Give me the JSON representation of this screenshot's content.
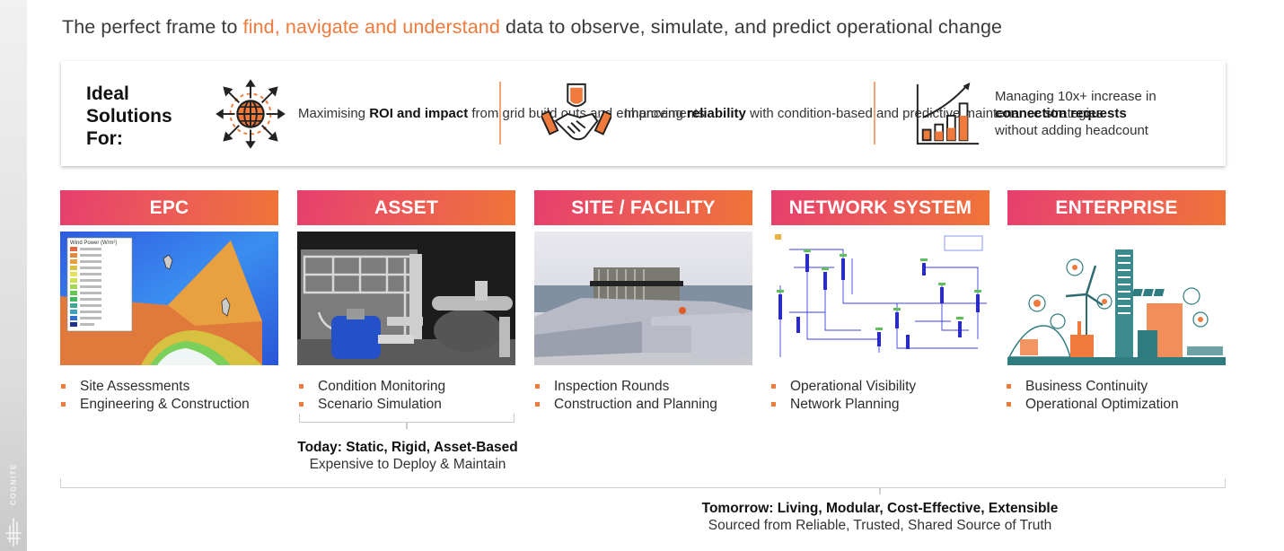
{
  "brand": {
    "name": "COGNITE"
  },
  "subtitle": {
    "prefix": "The perfect frame to ",
    "highlight": "find, navigate and understand",
    "suffix": " data to observe, simulate, and predict operational change"
  },
  "ideal": {
    "title_lines": [
      "Ideal",
      "Solutions",
      "For:"
    ],
    "benefits": [
      {
        "icon": "globe-expand-icon",
        "pre": "Maximising ",
        "bold": "ROI and impact",
        "post": " from grid build outs and enhancements"
      },
      {
        "icon": "handshake-shield-icon",
        "pre": "Improving ",
        "bold": "reliability",
        "post": " with condition-based and predictive maintenance strategies"
      },
      {
        "icon": "growth-chart-icon",
        "pre": "Managing 10x+ increase in ",
        "bold": "connection requests",
        "post": " without adding headcount"
      }
    ]
  },
  "columns": [
    {
      "title": "EPC",
      "image": "wind-power-map",
      "legend_title": "Wind Power (W/m²)",
      "bullets": [
        "Site Assessments",
        "Engineering & Construction"
      ]
    },
    {
      "title": "ASSET",
      "image": "point-cloud-equipment",
      "bullets": [
        "Condition Monitoring",
        "Scenario Simulation"
      ]
    },
    {
      "title": "SITE / FACILITY",
      "image": "facility-3d-model",
      "bullets": [
        "Inspection Rounds",
        "Construction and Planning"
      ]
    },
    {
      "title": "NETWORK SYSTEM",
      "image": "network-single-line-diagram",
      "bullets": [
        "Operational Visibility",
        "Network Planning"
      ]
    },
    {
      "title": "ENTERPRISE",
      "image": "smart-city-illustration",
      "bullets": [
        "Business Continuity",
        "Operational Optimization"
      ]
    }
  ],
  "today": {
    "title": "Today: Static, Rigid, Asset-Based",
    "subtitle": "Expensive to Deploy & Maintain"
  },
  "tomorrow": {
    "title": "Tomorrow: Living, Modular, Cost-Effective, Extensible",
    "subtitle": "Sourced from Reliable, Trusted, Shared Source of Truth"
  },
  "colors": {
    "accent": "#ef7a3c",
    "header_start": "#e63f6e",
    "header_end": "#ef7438"
  }
}
